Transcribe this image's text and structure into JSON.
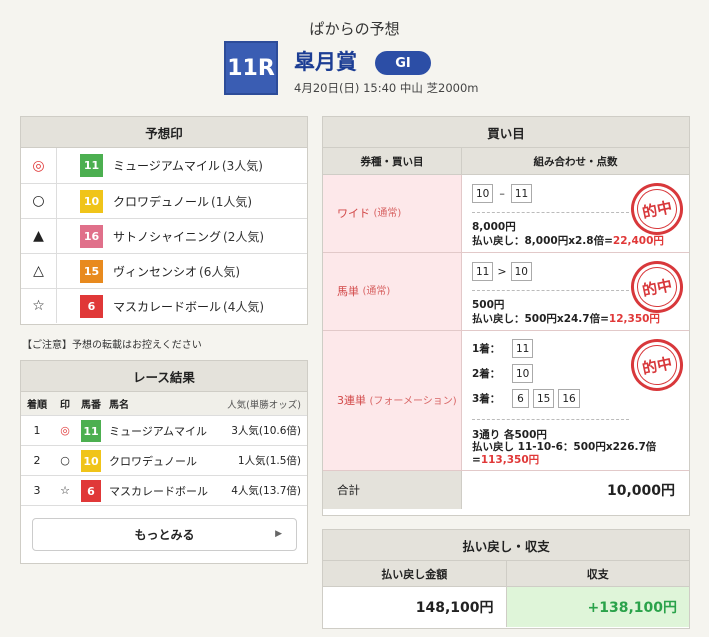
{
  "header": {
    "title": "ぱからの予想",
    "race_no": "11R",
    "race_name": "皐月賞",
    "grade": "GI",
    "meta": "4月20日(日) 15:40 中山 芝2000m"
  },
  "predictions": {
    "title": "予想印",
    "rows": [
      {
        "mark": "◎",
        "num": "11",
        "color": "#4caf50",
        "horse": "ミュージアムマイル",
        "pop": "(3人気)"
      },
      {
        "mark": "○",
        "num": "10",
        "color": "#f0c419",
        "horse": "クロワデュノール",
        "pop": "(1人気)"
      },
      {
        "mark": "▲",
        "num": "16",
        "color": "#e0708a",
        "horse": "サトノシャイニング",
        "pop": "(2人気)"
      },
      {
        "mark": "△",
        "num": "15",
        "color": "#e88a1e",
        "horse": "ヴィンセンシオ",
        "pop": "(6人気)"
      },
      {
        "mark": "☆",
        "num": "6",
        "color": "#e03838",
        "horse": "マスカレードボール",
        "pop": "(4人気)"
      }
    ]
  },
  "caution": "【ご注意】予想の転載はお控えください",
  "results": {
    "title": "レース結果",
    "headers": {
      "rank": "着順",
      "mark": "印",
      "num": "馬番",
      "name": "馬名",
      "pop": "人気(単勝オッズ)"
    },
    "rows": [
      {
        "rank": "1",
        "mark": "◎",
        "num": "11",
        "color": "#4caf50",
        "name": "ミュージアムマイル",
        "pop": "3人気(10.6倍)"
      },
      {
        "rank": "2",
        "mark": "○",
        "num": "10",
        "color": "#f0c419",
        "name": "クロワデュノール",
        "pop": "1人気(1.5倍)"
      },
      {
        "rank": "3",
        "mark": "☆",
        "num": "6",
        "color": "#e03838",
        "name": "マスカレードボール",
        "pop": "4人気(13.7倍)"
      }
    ],
    "more": "もっとみる"
  },
  "bets": {
    "title": "買い目",
    "col_type": "券種・買い目",
    "col_combo": "組み合わせ・点数",
    "stamp": "的中",
    "wide": {
      "type": "ワイド",
      "sub": "(通常)",
      "a": "10",
      "sep": "–",
      "b": "11",
      "amount": "8,000円",
      "pay_prefix": "払い戻し：8,000円x2.8倍=",
      "pay_value": "22,400円"
    },
    "umatan": {
      "type": "馬単",
      "sub": "(通常)",
      "a": "11",
      "sep": ">",
      "b": "10",
      "amount": "500円",
      "pay_prefix": "払い戻し：500円x24.7倍=",
      "pay_value": "12,350円"
    },
    "trifecta": {
      "type": "3連単",
      "sub": "(フォーメーション)",
      "first_label": "1着：",
      "first": [
        "11"
      ],
      "second_label": "2着：",
      "second": [
        "10"
      ],
      "third_label": "3着：",
      "third": [
        "6",
        "15",
        "16"
      ],
      "amount": "3通り 各500円",
      "pay_prefix": "払い戻し 11-10-6：500円x226.7倍=",
      "pay_value": "113,350円"
    },
    "total_label": "合計",
    "total_value": "10,000円"
  },
  "payout": {
    "title": "払い戻し・収支",
    "col_payout": "払い戻し金額",
    "col_balance": "収支",
    "payout_value": "148,100円",
    "balance_value": "+138,100円"
  }
}
